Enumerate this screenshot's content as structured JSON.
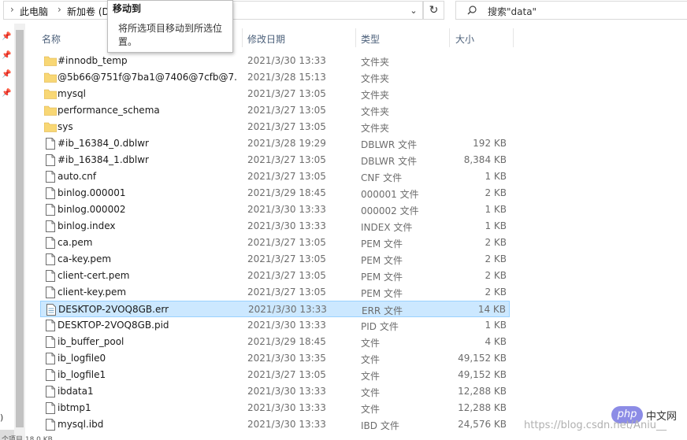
{
  "breadcrumb": {
    "root": "此电脑",
    "drive": "新加卷 (D",
    "separator": "›"
  },
  "search": {
    "placeholder": "搜索\"data\""
  },
  "tooltip": {
    "title": "移动到",
    "description": "将所选项目移动到所选位置。"
  },
  "columns": {
    "name": "名称",
    "date": "修改日期",
    "type": "类型",
    "size": "大小"
  },
  "nav": {
    "fragment": ")",
    "status_fragment": "个项目 18.0 KB"
  },
  "files": [
    {
      "name": "#innodb_temp",
      "date": "2021/3/30 13:33",
      "type": "文件夹",
      "size": "",
      "kind": "folder"
    },
    {
      "name": "@5b66@751f@7ba1@7406@7cfb@7...",
      "date": "2021/3/28 15:13",
      "type": "文件夹",
      "size": "",
      "kind": "folder"
    },
    {
      "name": "mysql",
      "date": "2021/3/27 13:05",
      "type": "文件夹",
      "size": "",
      "kind": "folder"
    },
    {
      "name": "performance_schema",
      "date": "2021/3/27 13:05",
      "type": "文件夹",
      "size": "",
      "kind": "folder"
    },
    {
      "name": "sys",
      "date": "2021/3/27 13:05",
      "type": "文件夹",
      "size": "",
      "kind": "folder"
    },
    {
      "name": "#ib_16384_0.dblwr",
      "date": "2021/3/28 19:29",
      "type": "DBLWR 文件",
      "size": "192 KB",
      "kind": "file"
    },
    {
      "name": "#ib_16384_1.dblwr",
      "date": "2021/3/27 13:05",
      "type": "DBLWR 文件",
      "size": "8,384 KB",
      "kind": "file"
    },
    {
      "name": "auto.cnf",
      "date": "2021/3/27 13:05",
      "type": "CNF 文件",
      "size": "1 KB",
      "kind": "file"
    },
    {
      "name": "binlog.000001",
      "date": "2021/3/29 18:45",
      "type": "000001 文件",
      "size": "2 KB",
      "kind": "file"
    },
    {
      "name": "binlog.000002",
      "date": "2021/3/30 13:33",
      "type": "000002 文件",
      "size": "1 KB",
      "kind": "file"
    },
    {
      "name": "binlog.index",
      "date": "2021/3/30 13:33",
      "type": "INDEX 文件",
      "size": "1 KB",
      "kind": "file"
    },
    {
      "name": "ca.pem",
      "date": "2021/3/27 13:05",
      "type": "PEM 文件",
      "size": "2 KB",
      "kind": "file"
    },
    {
      "name": "ca-key.pem",
      "date": "2021/3/27 13:05",
      "type": "PEM 文件",
      "size": "2 KB",
      "kind": "file"
    },
    {
      "name": "client-cert.pem",
      "date": "2021/3/27 13:05",
      "type": "PEM 文件",
      "size": "2 KB",
      "kind": "file"
    },
    {
      "name": "client-key.pem",
      "date": "2021/3/27 13:05",
      "type": "PEM 文件",
      "size": "2 KB",
      "kind": "file"
    },
    {
      "name": "DESKTOP-2VOQ8GB.err",
      "date": "2021/3/30 13:33",
      "type": "ERR 文件",
      "size": "14 KB",
      "kind": "textfile",
      "selected": true
    },
    {
      "name": "DESKTOP-2VOQ8GB.pid",
      "date": "2021/3/30 13:33",
      "type": "PID 文件",
      "size": "1 KB",
      "kind": "file"
    },
    {
      "name": "ib_buffer_pool",
      "date": "2021/3/29 18:45",
      "type": "文件",
      "size": "4 KB",
      "kind": "file"
    },
    {
      "name": "ib_logfile0",
      "date": "2021/3/30 13:35",
      "type": "文件",
      "size": "49,152 KB",
      "kind": "file"
    },
    {
      "name": "ib_logfile1",
      "date": "2021/3/27 13:05",
      "type": "文件",
      "size": "49,152 KB",
      "kind": "file"
    },
    {
      "name": "ibdata1",
      "date": "2021/3/30 13:33",
      "type": "文件",
      "size": "12,288 KB",
      "kind": "file"
    },
    {
      "name": "ibtmp1",
      "date": "2021/3/30 13:33",
      "type": "文件",
      "size": "12,288 KB",
      "kind": "file"
    },
    {
      "name": "mysql.ibd",
      "date": "2021/3/30 13:33",
      "type": "IBD 文件",
      "size": "24,576 KB",
      "kind": "file"
    }
  ],
  "watermark": {
    "logo": "php",
    "cn": "中文网",
    "url": "https://blog.csdn.net/Aniu__"
  },
  "colors": {
    "selection": "#cce8ff",
    "selection_border": "#99d1ff",
    "folder": "#f8d775",
    "header_text": "#4c607a"
  }
}
